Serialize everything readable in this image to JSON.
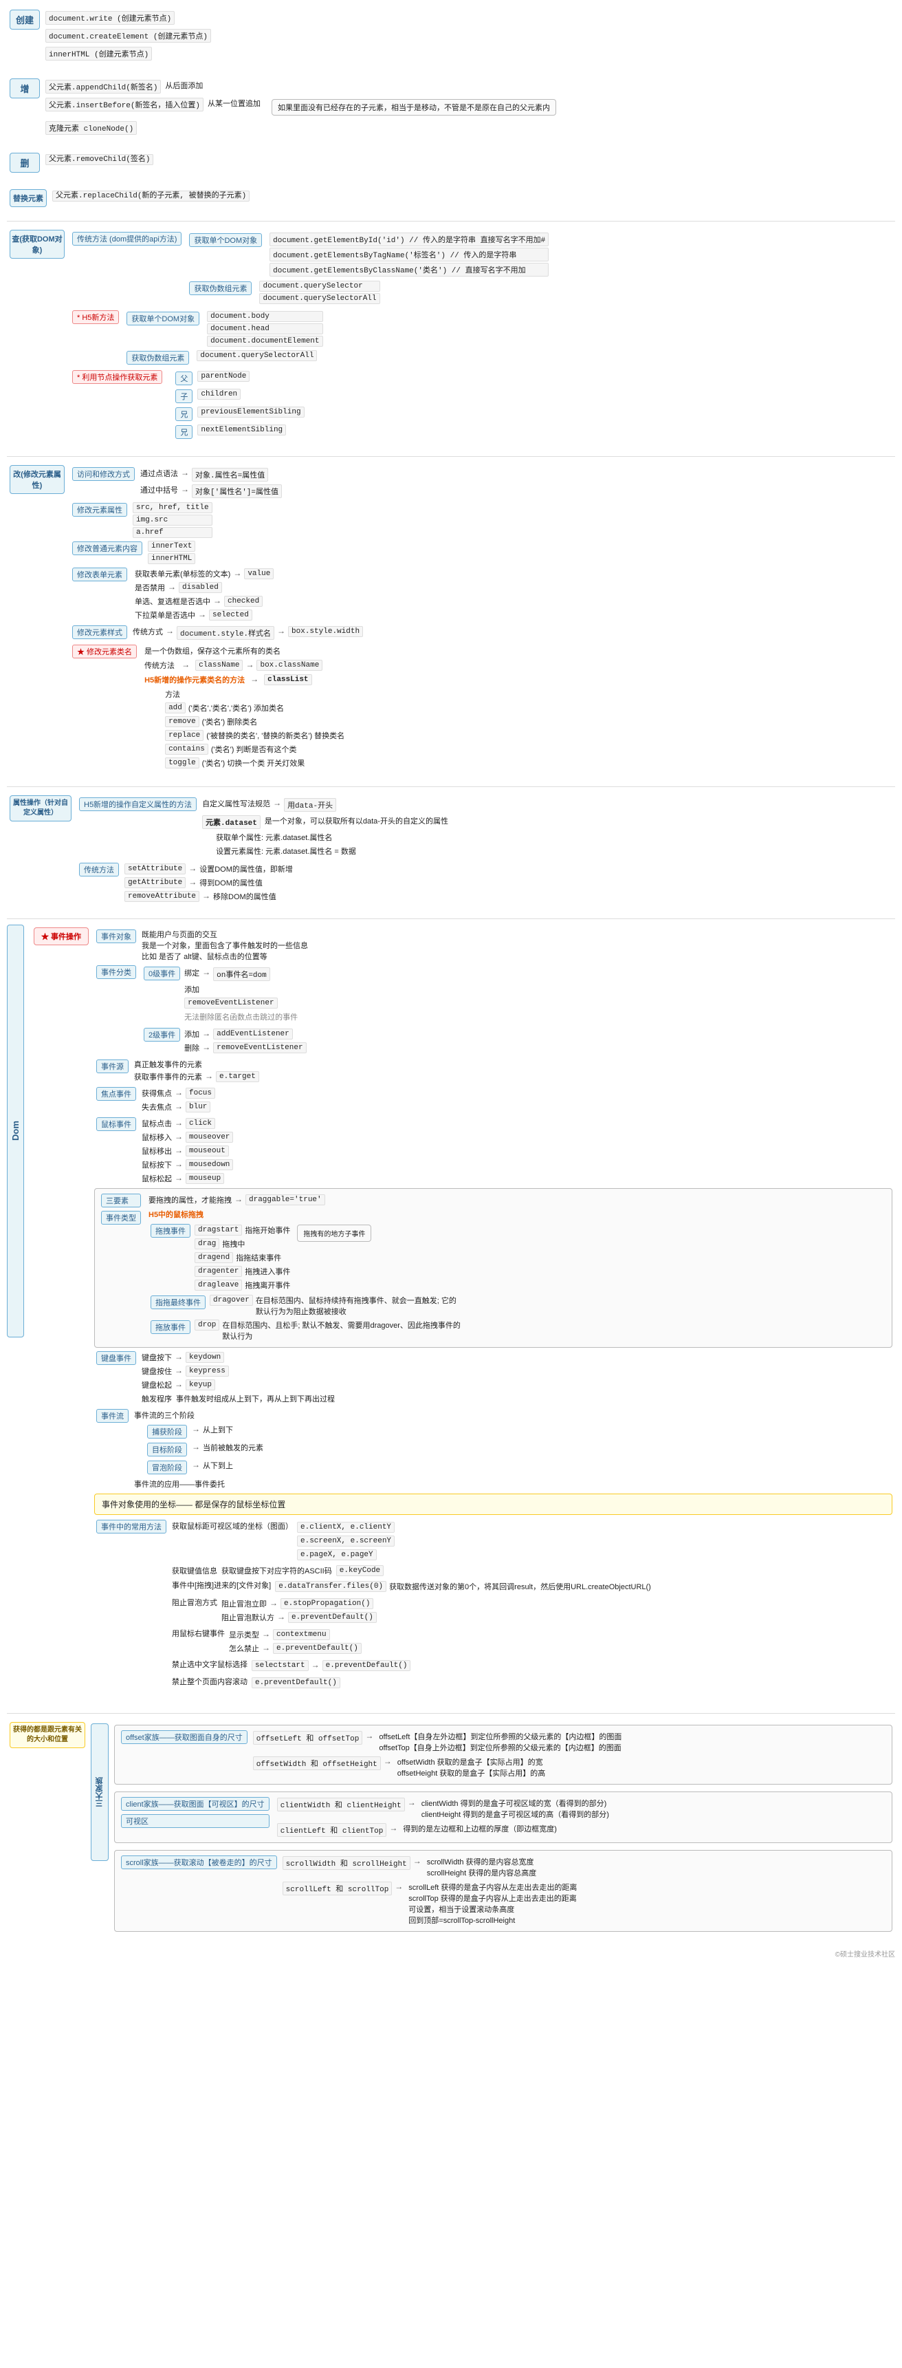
{
  "title": "DOM",
  "sections": {
    "create": {
      "label": "创建",
      "items": [
        "document.write (创建元素节点)",
        "document.createElement (创建元素节点)",
        "innerHTML (创建元素节点)"
      ]
    },
    "add": {
      "label": "增",
      "items": [
        "父元素.appendChild(新签名) 从后面添加",
        "父元素.insertBefore(新签名，插入位置) 从某一位置追加",
        "克隆元素 cloneNode()"
      ],
      "note": "如果里面没有已经存在的子元素，相当于是移动，不管是不是原在自己的父元素内"
    },
    "delete": {
      "label": "删",
      "item": "父元素.removeChild(签名)"
    },
    "replace": {
      "label": "替换元素",
      "item": "父元素.replaceChild(新的子元素, 被替换的子元素)"
    },
    "query": {
      "label": "查(获取DOM对象)",
      "h5_methods": "* H5新方法",
      "traditional": {
        "label": "传统方法 (dom提供的api方法)",
        "single": {
          "label": "获取单个DOM对象",
          "items": [
            "document.getElementById('id') // 传入的是字符串 直接写名字不用加#",
            "document.getElementsByTagName('标签名') // 传入的是字符串",
            "document.getElementsByClassName('类名') // 直接写名字不用加"
          ]
        },
        "multiple": {
          "label": "获取伪数组元素",
          "items": [
            "document.querySelector",
            "document.querySelectorAll"
          ]
        }
      },
      "h5": {
        "label": "获取单个DOM对象",
        "items": [
          "document.body",
          "document.head",
          "document.documentElement"
        ],
        "all": {
          "label": "获取伪数组元素",
          "item": "document.querySelectorAll"
        }
      },
      "node": {
        "label": "* 利用节点操作获取元素",
        "items": [
          {
            "label": "父",
            "value": "parentNode"
          },
          {
            "label": "子",
            "value": "children"
          },
          {
            "label": "兄",
            "value": "previousElementSibling"
          },
          {
            "label": "兄",
            "value": "nextElementSibling"
          }
        ]
      }
    },
    "modify": {
      "label": "改(修改元素属性)",
      "visit_change": {
        "label": "访问和修改方式",
        "items": [
          {
            "method": "通过点语法",
            "desc": "对象.属性名=属性值"
          },
          {
            "method": "通过中括号",
            "desc": "对象['属性名']=属性值"
          }
        ]
      },
      "attr": {
        "label": "修改元素属性",
        "items": [
          "src, href, title",
          "img.src",
          "a.href"
        ]
      },
      "text": {
        "label": "修改普通元素内容",
        "items": [
          "innerText",
          "innerHTML"
        ]
      },
      "input": {
        "label": "修改表单元素",
        "items": [
          {
            "desc": "获取表单元素(单标签的文本)",
            "prop": "value"
          },
          {
            "desc": "是否禁用",
            "prop": "disabled"
          },
          {
            "desc": "单选、复选框是否选中",
            "prop": "checked"
          },
          {
            "desc": "下拉菜单是否选中",
            "prop": "selected"
          }
        ]
      },
      "style": {
        "label": "修改元素样式",
        "method": "传统方式",
        "prop1": "document.style.样式名",
        "prop2": "box.style.width"
      },
      "classname": {
        "label": "★ 修改元素类名",
        "h5_label": "H5新增的操作元素类名的方法",
        "classList": "classList",
        "methods": [
          {
            "action": "add",
            "desc": "('类名','类名','类名') 添加类名"
          },
          {
            "action": "remove",
            "desc": "('类名') 删除类名"
          },
          {
            "action": "replace",
            "desc": "('被替换的类名', '替换的新类名') 替换类名"
          },
          {
            "action": "contains",
            "desc": "('类名') 判断是否有这个类"
          },
          {
            "action": "toggle",
            "desc": "('类名') 切换一个类 开关灯效果"
          }
        ],
        "className_desc": "是一个伪数组，保存这个元素所有的类名",
        "method_label": "传统方法",
        "className_prop": "className"
      }
    },
    "attr_operation": {
      "label": "属性操作（针对自定义属性）",
      "h5_custom": {
        "label": "H5新增的操作自定义属性的方法",
        "rule": "自定义属性写法规范",
        "rule_val": "用data-开头",
        "dataset": {
          "label": "元素.dataset",
          "desc": "是一个对象，可以获取所有以data-开头的自定义的属性",
          "get": "获取单个属性: 元素.dataset.属性名",
          "set": "设置元素属性: 元素.dataset.属性名 = 数据"
        }
      },
      "traditional": {
        "label": "传统方法",
        "items": [
          {
            "method": "setAttribute",
            "desc": "设置DOM的属性值，即新增"
          },
          {
            "method": "getAttribute",
            "desc": "得到DOM的属性值"
          },
          {
            "method": "removeAttribute",
            "desc": "移除DOM的属性值"
          }
        ]
      }
    },
    "events": {
      "label": "★ 事件操作",
      "event_obj": {
        "label": "事件对象",
        "desc1": "既能用户与页面的交互",
        "desc2": "我是一个对象，里面包含了事件触发时的一些信息",
        "desc3": "比如 是否了 alt键、鼠标点击的位置等"
      },
      "event_type": {
        "label": "事件分类",
        "dom0": {
          "label": "0级事件",
          "bind": "on事件名=dom",
          "add": "添加",
          "remove": "removeEventListener",
          "remove_note": "无法删除匿名函数点击跳过的事件"
        },
        "dom2": {
          "label": "2级事件",
          "add": "addEventListener"
        }
      },
      "event_source": {
        "label": "事件源",
        "desc": "真正触发事件的元素",
        "target": "e.target",
        "types": {
          "focus": {
            "label": "焦点事件",
            "items": [
              {
                "desc": "获得焦点",
                "event": "focus"
              },
              {
                "desc": "失去焦点",
                "event": "blur"
              }
            ]
          },
          "mouse": {
            "label": "鼠标事件",
            "items": [
              {
                "desc": "鼠标点击",
                "event": "click"
              },
              {
                "desc": "鼠标移入",
                "event": "mouseover"
              },
              {
                "desc": "鼠标移出",
                "event": "mouseout"
              },
              {
                "desc": "鼠标按下",
                "event": "mousedown"
              },
              {
                "desc": "鼠标松起",
                "event": "mouseup"
              }
            ]
          },
          "drag": {
            "label": "鼠标事件",
            "three_elements_label": "三要素",
            "event_type_label": "事件类型",
            "draggable": "dragable='true'",
            "drag_events_label": "H5中的鼠标拖拽",
            "drag_events": [
              {
                "event": "dragstart",
                "desc": "指拖开始事件"
              },
              {
                "event": "drag",
                "desc": "拖拽中"
              },
              {
                "event": "dragend",
                "desc": "指拖结束事件"
              },
              {
                "event": "dragenter",
                "desc": "拖拽进入事件"
              },
              {
                "event": "dragleave",
                "desc": "拖拽离开事件"
              }
            ],
            "finger_drag": {
              "label": "指拖最终事件",
              "event": "dragover",
              "desc": "在目标范围内、鼠标持续持有拖拽事件、就会一直触发; 它的默认行为为阻止数据被接收"
            },
            "drop": {
              "label": "拖放事件",
              "event": "drop",
              "desc": "在目标范围内、且松手; 默认不触发、需要用dragover、因此拖拽事件的默认行为"
            }
          },
          "keyboard": {
            "label": "键盘事件",
            "order_label": "触发程序",
            "items": [
              {
                "desc": "键盘按下",
                "event": "keydown"
              },
              {
                "desc": "键盘按住",
                "event": "keypress"
              },
              {
                "desc": "键盘松起",
                "event": "keyup"
              }
            ],
            "order_desc": "事件触发时组成从上到下，再从上到下再出过程"
          }
        }
      },
      "event_flow": {
        "label": "事件流",
        "three_stages": {
          "label": "事件流的三个阶段",
          "items": [
            {
              "label": "捕获阶段",
              "desc": "从上到下"
            },
            {
              "label": "目标阶段",
              "desc": "当前被触发的元素"
            },
            {
              "label": "冒泡阶段",
              "desc": "从下到上"
            }
          ]
        },
        "application_label": "事件流的应用——事件委托"
      },
      "event_target_label": "事件对象使用的坐标—— 都是保存的鼠标坐标位置",
      "event_methods": {
        "label": "事件中的常用方法",
        "coords": {
          "full_label": "获取鼠标距可视区域的坐标（图面）",
          "items": [
            {
              "prop": "e.clientX, e.clientY"
            },
            {
              "prop": "e.screenX, e.screenY"
            },
            {
              "prop": "e.pageX, e.pageY"
            }
          ]
        },
        "keycode": {
          "label": "获取键值信息",
          "desc": "获取键盘按下对应字符的ASCII码",
          "prop": "e.keyCode"
        },
        "file": {
          "label": "事件中[拖拽]进来的[文件对象]",
          "items": [
            {
              "method": "e.dataTransfer.files(0)",
              "desc": "获取数据传送对象的第0个，将其回调result，然后使用URL.createObjectURL()"
            }
          ]
        },
        "bubble": {
          "label": "阻止冒泡方式",
          "items": [
            {
              "action": "阻止冒泡立即",
              "method": "e.stopPropagation()"
            },
            {
              "action": "阻止冒泡默认方",
              "method": "e.preventDefault()"
            }
          ]
        },
        "context": {
          "label": "用鼠标右键事件",
          "show_type": "contextmenu",
          "items": [
            {
              "action": "怎么禁止",
              "method": "e.preventDefault()"
            }
          ]
        },
        "select": {
          "label": "禁止选中文字鼠标选择",
          "items": [
            {
              "event": "selectstart",
              "method": "e.preventDefault()"
            }
          ]
        },
        "scroll": {
          "label": "禁止整个页面内容滚动",
          "items": [
            {
              "event": "",
              "method": "e.preventDefault()"
            }
          ]
        }
      }
    },
    "size_position": {
      "label": "获得的都是跟元素有关的大小和位置",
      "offset": {
        "label": "offset家族——获取图面自身的尺寸",
        "items": [
          {
            "prop": "offsetLeft 和 offsetTop",
            "desc": "offsetLeft【自身左外边框】到定位所参照的父级元素的【内边框】的图面; offsetTop【自身上外边框】到定位所参照的父级元素的【内边框】的图面"
          },
          {
            "prop": "offsetWidth 和 offsetHeight",
            "desc": "offsetWidth 获取的是盒子【实际占用】的宽; offsetHeight 获取的是盒子【实际占用】的高"
          }
        ]
      },
      "client": {
        "label": "client家族——获取图面【可视区】的尺寸",
        "note": "可视区",
        "items": [
          {
            "prop": "clientWidth 和 clientHeight",
            "desc": "clientWidth 得到的是盒子可视区域的宽（看得到的部分); clientHeight 得到的是盒子可视区域的高（看得到的部分)"
          },
          {
            "prop": "clientLeft 和 clientTop",
            "desc": "得到的是左边框和上边框的厚度（即边框宽度)"
          }
        ]
      },
      "scroll": {
        "label": "scroll家族——获取滚动【被卷走的】的尺寸",
        "items": [
          {
            "prop": "scrollWidth 和 scrollHeight",
            "desc": "scrollWidth 获得的是内容总宽度; scrollHeight 获得的是内容总高度"
          },
          {
            "prop": "scrollLeft 和 scrollTop",
            "desc": "scrollLeft 获得的是盒子内容从左走出去走出的距离; scrollTop 获得的是盒子内容从上走出去走出的距离; 可设置，相当于设置滚动条高度; 回到顶部=scrollTop-scrollHeight"
          }
        ]
      }
    }
  }
}
